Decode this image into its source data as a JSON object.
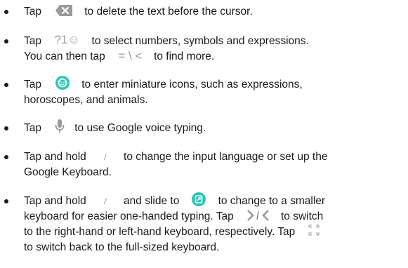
{
  "items": [
    {
      "line1_a": "Tap",
      "icon1": "delete-key-icon",
      "line1_b": "to delete the text before the cursor."
    },
    {
      "line1_a": "Tap",
      "icon1": "symbols-key-icon",
      "icon1_text": "?1☺",
      "line1_b": "to select numbers, symbols and expressions.",
      "line2_a": "You can then tap",
      "icon2": "more-symbols-icon",
      "icon2_text": "= \\ <",
      "line2_b": "to find more."
    },
    {
      "line1_a": "Tap",
      "icon1": "emoji-key-icon",
      "line1_b": "to enter miniature icons, such as expressions,",
      "line2": "horoscopes, and animals."
    },
    {
      "line1_a": "Tap",
      "icon1": "microphone-icon",
      "line1_b": "to use Google voice typing."
    },
    {
      "line1_a": "Tap and hold",
      "icon1": "comma-key-icon",
      "line1_b": "to change the input language or set up the",
      "line2": "Google Keyboard."
    },
    {
      "line1_a": "Tap and hold",
      "icon1": "comma-key-icon",
      "line1_b": "and slide to",
      "icon2": "one-handed-mode-icon",
      "line1_c": "to change to a smaller",
      "line2_a": "keyboard for easier one-handed typing. Tap",
      "icon3": "arrow-right-left-icon",
      "line2_b": "to switch",
      "line3_a": "to the right-hand or left-hand keyboard, respectively. Tap",
      "icon4": "expand-icon",
      "line4": "to switch back to the full-sized keyboard."
    }
  ],
  "colors": {
    "text": "#1a1a1a",
    "icon_gray": "#9a9a9a",
    "icon_teal": "#2ec4b6"
  }
}
